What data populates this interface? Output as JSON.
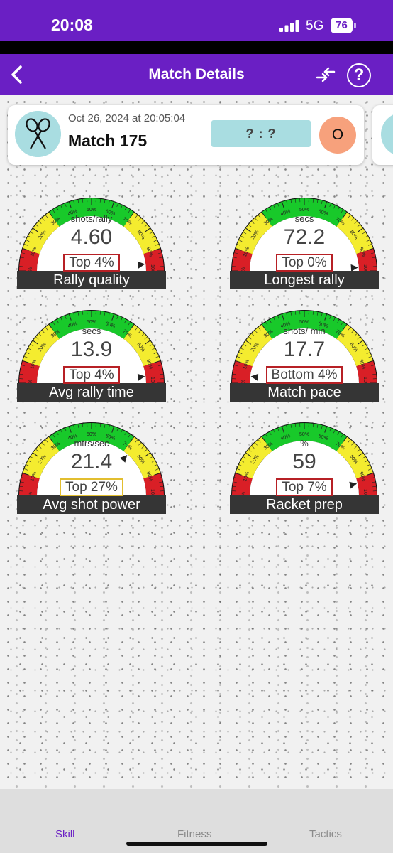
{
  "status_bar": {
    "time": "20:08",
    "network": "5G",
    "battery": "76"
  },
  "nav": {
    "title": "Match Details",
    "back_icon": "chevron-left-icon",
    "compare_icon": "compare-arrows-icon",
    "help_icon": "?"
  },
  "match": {
    "date": "Oct 26, 2024 at 20:05:04",
    "name": "Match 175",
    "score": "? : ?",
    "opponent_initial": "O",
    "avatar_icon": "crossed-rackets-icon"
  },
  "colors": {
    "brand": "#6a1fc4",
    "red": "#d91f26",
    "yellow": "#f4ec2f",
    "green": "#18c92a",
    "card_avatar": "#a9dde1",
    "opponent_avatar": "#f7a17c"
  },
  "scale_ticks": [
    "0%",
    "10%",
    "20%",
    "30%",
    "40%",
    "50%",
    "60%",
    "70%",
    "80%",
    "90%",
    "100%"
  ],
  "gauges": [
    {
      "unit": "shots/rally",
      "value": "4.60",
      "badge": "Top 4%",
      "badge_color": "red",
      "label": "Rally quality",
      "needle_percent": 96
    },
    {
      "unit": "secs",
      "value": "72.2",
      "badge": "Top 0%",
      "badge_color": "red",
      "label": "Longest rally",
      "needle_percent": 100
    },
    {
      "unit": "secs",
      "value": "13.9",
      "badge": "Top 4%",
      "badge_color": "red",
      "label": "Avg rally time",
      "needle_percent": 96
    },
    {
      "unit": "shots/ min",
      "value": "17.7",
      "badge": "Bottom 4%",
      "badge_color": "red",
      "label": "Match pace",
      "needle_percent": 4
    },
    {
      "unit": "mtrs/sec",
      "value": "21.4",
      "badge": "Top 27%",
      "badge_color": "yellow",
      "label": "Avg shot power",
      "needle_percent": 73
    },
    {
      "unit": "%",
      "value": "59",
      "badge": "Top 7%",
      "badge_color": "red",
      "label": "Racket prep",
      "needle_percent": 93
    }
  ],
  "tabs": [
    "Skill",
    "Fitness",
    "Tactics"
  ]
}
